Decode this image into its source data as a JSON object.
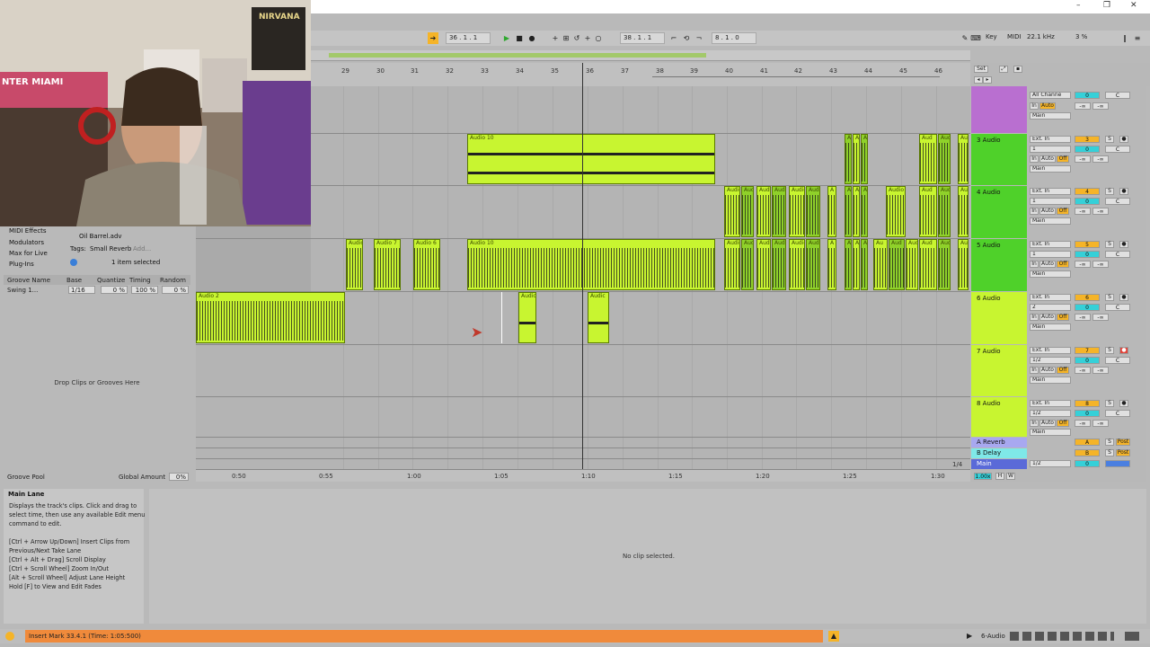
{
  "window": {
    "minimize": "–",
    "restore": "❐",
    "close": "✕"
  },
  "transport": {
    "arrangement_position": "36 .  1 .  1",
    "loop_start": "38 .  1 .  1",
    "loop_length": "8 .  1 .  0",
    "key_label": "Key",
    "midi_label": "MIDI",
    "sample_rate": "22.1 kHz",
    "cpu": "3 %"
  },
  "ruler": {
    "bars": [
      "29",
      "30",
      "31",
      "32",
      "33",
      "34",
      "35",
      "36",
      "37",
      "38",
      "39",
      "40",
      "41",
      "42",
      "43",
      "44",
      "45",
      "46"
    ]
  },
  "time_axis": {
    "labels": [
      "0:50",
      "0:55",
      "1:00",
      "1:05",
      "1:10",
      "1:15",
      "1:20",
      "1:25",
      "1:30"
    ],
    "zoom": "1/4"
  },
  "clips": {
    "audio10_a": "Audio 10",
    "audio10_b": "Audio 10",
    "audio2": "Audio 2",
    "audio7": "Audio 7",
    "audio6": "Audio 6",
    "audio_short": "Audic",
    "audio_generic": "Audio",
    "aud": "Aud",
    "au": "Au",
    "a": "A"
  },
  "tracks": [
    {
      "name": "",
      "input": "All Channe",
      "channel": "",
      "number": "",
      "volume": "0",
      "pan": "C",
      "color": "#b96fd0"
    },
    {
      "name": "3 Audio",
      "input": "Ext. In",
      "channel": "1",
      "number": "3",
      "volume": "0",
      "pan": "C",
      "color": "#4fd12a"
    },
    {
      "name": "4 Audio",
      "input": "Ext. In",
      "channel": "1",
      "number": "4",
      "volume": "0",
      "pan": "C",
      "color": "#4fd12a"
    },
    {
      "name": "5 Audio",
      "input": "Ext. In",
      "channel": "1",
      "number": "5",
      "volume": "0",
      "pan": "C",
      "color": "#4fd12a"
    },
    {
      "name": "6 Audio",
      "input": "Ext. In",
      "channel": "2",
      "number": "6",
      "volume": "0",
      "pan": "C",
      "color": "#c8f530"
    },
    {
      "name": "7 Audio",
      "input": "Ext. In",
      "channel": "1/2",
      "number": "7",
      "volume": "0",
      "pan": "C",
      "color": "#c8f530"
    },
    {
      "name": "8 Audio",
      "input": "Ext. In",
      "channel": "1/2",
      "number": "8",
      "volume": "0",
      "pan": "C",
      "color": "#c8f530"
    }
  ],
  "mixer_labels": {
    "in": "In",
    "auto": "Auto",
    "off": "Off",
    "out": "Main",
    "inf": "-∞",
    "s": "S",
    "set": "Set"
  },
  "returns": [
    {
      "name": "A Reverb",
      "letter": "A",
      "post": "Post",
      "color": "#a8a8f0"
    },
    {
      "name": "B Delay",
      "letter": "B",
      "post": "Post",
      "color": "#7fe8e8"
    },
    {
      "name": "Main",
      "channel": "1/2",
      "volume": "0",
      "color": "#5a6ad8"
    }
  ],
  "main_zoom": "1.00x",
  "browser": {
    "items": [
      "MIDI Effects",
      "Modulators",
      "Max for Live",
      "Plug-Ins"
    ],
    "file": "Oil Barrel.adv",
    "tags_label": "Tags:",
    "tags_value": "Small Reverb",
    "tags_add": "Add...",
    "selected": "1 item selected"
  },
  "groove": {
    "headers": [
      "Groove Name",
      "Base",
      "Quantize",
      "Timing",
      "Random"
    ],
    "row": {
      "name": "Swing 1...",
      "base": "1/16",
      "quantize": "0 %",
      "timing": "100 %",
      "random": "0 %"
    },
    "drop_text": "Drop Clips or Grooves Here",
    "pool_label": "Groove Pool",
    "global_amount_label": "Global Amount",
    "global_amount": "0%"
  },
  "info": {
    "title": "Main Lane",
    "lines": [
      "Displays the track's clips. Click and drag to",
      "select time, then use any available Edit menu",
      "command to edit.",
      "",
      "[Ctrl + Arrow Up/Down] Insert Clips from",
      "Previous/Next Take Lane",
      "[Ctrl + Alt + Drag] Scroll Display",
      "[Ctrl + Scroll Wheel] Zoom In/Out",
      "[Alt + Scroll Wheel] Adjust Lane Height",
      "Hold [F] to View and Edit Fades"
    ]
  },
  "detail": {
    "empty": "No clip selected."
  },
  "status": {
    "message": "Insert Mark 33.4.1 (Time: 1:05:500)",
    "track": "6-Audio"
  },
  "webcam": {
    "poster_text": "NIRVANA",
    "banner_text": "NTER MIAMI"
  }
}
